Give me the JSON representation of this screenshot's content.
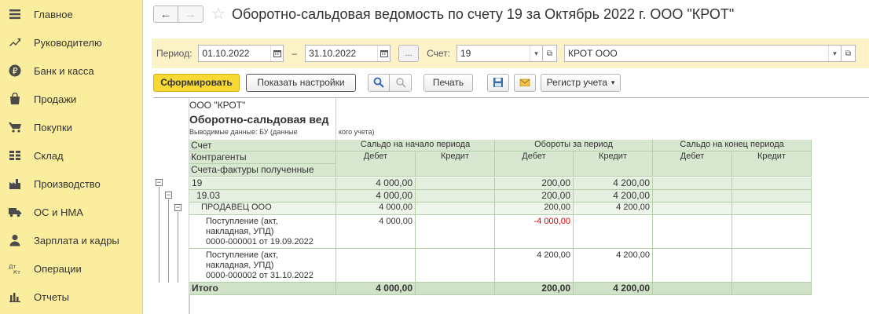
{
  "sidebar": {
    "items": [
      {
        "icon": "menu-icon",
        "label": "Главное"
      },
      {
        "icon": "chart-trend-icon",
        "label": "Руководителю"
      },
      {
        "icon": "ruble-icon",
        "label": "Банк и касса"
      },
      {
        "icon": "shopping-bag-icon",
        "label": "Продажи"
      },
      {
        "icon": "cart-icon",
        "label": "Покупки"
      },
      {
        "icon": "warehouse-icon",
        "label": "Склад"
      },
      {
        "icon": "factory-icon",
        "label": "Производство"
      },
      {
        "icon": "truck-icon",
        "label": "ОС и НМА"
      },
      {
        "icon": "person-icon",
        "label": "Зарплата и кадры"
      },
      {
        "icon": "dt-kt-icon",
        "label": "Операции"
      },
      {
        "icon": "bar-chart-icon",
        "label": "Отчеты"
      }
    ]
  },
  "header": {
    "back": "←",
    "forward": "→",
    "star": "☆",
    "title": "Оборотно-сальдовая ведомость по счету 19 за Октябрь 2022 г. ООО \"КРОТ\""
  },
  "params": {
    "period_label": "Период:",
    "date_from": "01.10.2022",
    "dash": "–",
    "date_to": "31.10.2022",
    "more": "...",
    "account_label": "Счет:",
    "account": "19",
    "organization": "КРОТ ООО"
  },
  "toolbar": {
    "generate": "Сформировать",
    "show_settings": "Показать настройки",
    "print": "Печать",
    "register": "Регистр учета"
  },
  "report": {
    "org": "ООО \"КРОТ\"",
    "title": "Оборотно-сальдовая вед",
    "note_left": "Выводимые данные: БУ (данные",
    "note_right": "кого учета)",
    "headers": {
      "account": "Счет",
      "counterparties": "Контрагенты",
      "invoices": "Счета-фактуры полученные",
      "opening": "Сальдо на начало периода",
      "turnover": "Обороты за период",
      "closing": "Сальдо на конец периода",
      "debit": "Дебет",
      "credit": "Кредит"
    },
    "rows": [
      {
        "name": "19",
        "ob_d": "4 000,00",
        "ob_c": "",
        "t_d": "200,00",
        "t_c": "4 200,00",
        "cl_d": "",
        "cl_c": ""
      },
      {
        "name": "19.03",
        "ob_d": "4 000,00",
        "ob_c": "",
        "t_d": "200,00",
        "t_c": "4 200,00",
        "cl_d": "",
        "cl_c": ""
      },
      {
        "name": "ПРОДАВЕЦ ООО",
        "ob_d": "4 000,00",
        "ob_c": "",
        "t_d": "200,00",
        "t_c": "4 200,00",
        "cl_d": "",
        "cl_c": ""
      },
      {
        "line1": "Поступление (акт,",
        "line2": "накладная, УПД)",
        "line3": "0000-000001 от 19.09.2022",
        "ob_d": "4 000,00",
        "ob_c": "",
        "t_d": "-4 000,00",
        "t_c": "",
        "cl_d": "",
        "cl_c": ""
      },
      {
        "line1": "Поступление (акт,",
        "line2": "накладная, УПД)",
        "line3": "0000-000002 от 31.10.2022",
        "ob_d": "",
        "ob_c": "",
        "t_d": "4 200,00",
        "t_c": "4 200,00",
        "cl_d": "",
        "cl_c": ""
      }
    ],
    "total": {
      "name": "Итого",
      "ob_d": "4 000,00",
      "ob_c": "",
      "t_d": "200,00",
      "t_c": "4 200,00",
      "cl_d": "",
      "cl_c": ""
    },
    "tree_collapse": "−"
  },
  "colors": {
    "sidebar_bg": "#fbed9e",
    "params_bg": "#fbf2c8",
    "primary_btn": "#f8d933",
    "header_green": "#d8e8d0",
    "negative": "#d60000"
  }
}
